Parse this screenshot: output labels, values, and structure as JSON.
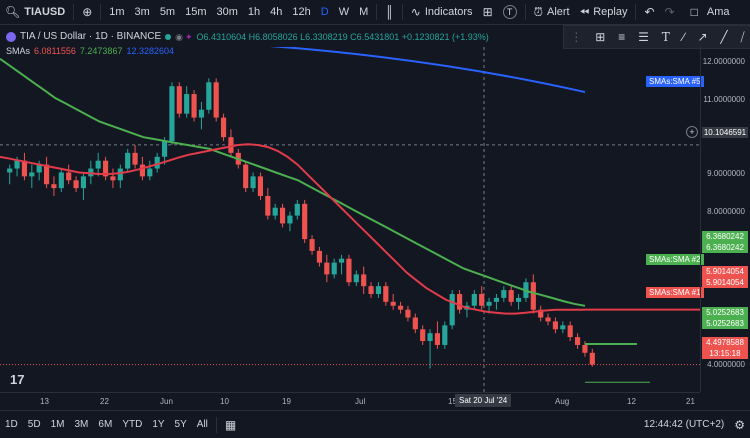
{
  "topbar": {
    "symbol": "TIAUSD",
    "intervals": [
      "1m",
      "3m",
      "5m",
      "15m",
      "30m",
      "1h",
      "4h",
      "12h",
      "D",
      "W",
      "M"
    ],
    "active_interval": "D",
    "indicators_label": "Indicators",
    "alert_label": "Alert",
    "replay_label": "Replay",
    "extra_label": "Ama"
  },
  "legend": {
    "title": "TIA / US Dollar · 1D · BINANCE",
    "ohlc": "O6.4310604 H6.8058026 L6.3308219 C6.5431801 +0.1230821 (+1.93%)",
    "sma_label": "SMAs",
    "sma1": "6.0811556",
    "sma2": "7.2473867",
    "sma3": "12.3282604"
  },
  "price_axis": {
    "labels": [
      "12.0000000",
      "11.0000000",
      "10.1046591",
      "9.0000000",
      "8.0000000",
      "6.3680242",
      "6.3680242",
      "5.9014054",
      "5.9014054",
      "5.0252683",
      "5.0252683",
      "4.4978588",
      "13:15:18",
      "4.0000000"
    ]
  },
  "sma_tags": {
    "sma5": "SMAs:SMA #5",
    "sma2": "SMAs:SMA #2",
    "sma1": "SMAs:SMA #1"
  },
  "time_axis": {
    "labels": [
      "13",
      "22",
      "Jun",
      "10",
      "19",
      "Jul",
      "15",
      "Sat 20 Jul '24",
      "Aug",
      "12",
      "21"
    ]
  },
  "bottombar": {
    "ranges": [
      "1D",
      "5D",
      "1M",
      "3M",
      "6M",
      "YTD",
      "1Y",
      "5Y",
      "All"
    ],
    "clock": "12:44:42 (UTC+2)"
  },
  "colors": {
    "up": "#26a69a",
    "down": "#ef5350",
    "sma_red": "#e23b4a",
    "sma_green": "#4caf50",
    "sma_blue": "#2962ff"
  },
  "chart_data": {
    "type": "candlestick",
    "candles": [
      [
        9.4,
        9.6,
        9.1,
        9.5
      ],
      [
        9.5,
        9.8,
        9.3,
        9.7
      ],
      [
        9.7,
        9.9,
        9.2,
        9.3
      ],
      [
        9.3,
        9.6,
        9.0,
        9.4
      ],
      [
        9.4,
        9.7,
        9.2,
        9.6
      ],
      [
        9.6,
        9.8,
        9.0,
        9.1
      ],
      [
        9.1,
        9.3,
        8.8,
        9.0
      ],
      [
        9.0,
        9.5,
        8.9,
        9.4
      ],
      [
        9.4,
        9.6,
        9.1,
        9.2
      ],
      [
        9.2,
        9.3,
        8.9,
        9.0
      ],
      [
        9.0,
        9.4,
        8.7,
        9.3
      ],
      [
        9.3,
        9.7,
        9.1,
        9.5
      ],
      [
        9.5,
        9.9,
        9.3,
        9.7
      ],
      [
        9.7,
        9.8,
        9.2,
        9.3
      ],
      [
        9.3,
        9.5,
        9.0,
        9.2
      ],
      [
        9.2,
        9.6,
        9.0,
        9.5
      ],
      [
        9.5,
        10.0,
        9.4,
        9.9
      ],
      [
        9.9,
        10.1,
        9.5,
        9.6
      ],
      [
        9.6,
        9.8,
        9.2,
        9.3
      ],
      [
        9.3,
        9.7,
        9.2,
        9.5
      ],
      [
        9.5,
        9.9,
        9.4,
        9.8
      ],
      [
        9.8,
        10.3,
        9.6,
        10.2
      ],
      [
        10.2,
        11.7,
        10.1,
        11.6
      ],
      [
        11.6,
        11.7,
        10.8,
        10.9
      ],
      [
        10.9,
        11.6,
        10.8,
        11.4
      ],
      [
        11.4,
        11.5,
        10.7,
        10.8
      ],
      [
        10.8,
        11.2,
        10.5,
        11.0
      ],
      [
        11.0,
        11.8,
        10.9,
        11.7
      ],
      [
        11.7,
        11.8,
        10.7,
        10.8
      ],
      [
        10.8,
        10.9,
        10.2,
        10.3
      ],
      [
        10.3,
        10.5,
        9.8,
        9.9
      ],
      [
        9.9,
        10.0,
        9.5,
        9.6
      ],
      [
        9.6,
        9.7,
        8.9,
        9.0
      ],
      [
        9.0,
        9.4,
        8.9,
        9.3
      ],
      [
        9.3,
        9.4,
        8.7,
        8.8
      ],
      [
        8.8,
        9.0,
        8.2,
        8.3
      ],
      [
        8.3,
        8.6,
        8.2,
        8.5
      ],
      [
        8.5,
        8.6,
        8.0,
        8.1
      ],
      [
        8.1,
        8.4,
        7.9,
        8.3
      ],
      [
        8.3,
        8.7,
        8.2,
        8.6
      ],
      [
        8.6,
        8.7,
        7.6,
        7.7
      ],
      [
        7.7,
        7.8,
        7.3,
        7.4
      ],
      [
        7.4,
        7.5,
        7.0,
        7.1
      ],
      [
        7.1,
        7.3,
        6.6,
        6.8
      ],
      [
        6.8,
        7.2,
        6.7,
        7.1
      ],
      [
        7.1,
        7.3,
        6.8,
        7.2
      ],
      [
        7.2,
        7.3,
        6.5,
        6.6
      ],
      [
        6.6,
        6.9,
        6.5,
        6.8
      ],
      [
        6.8,
        7.0,
        6.3,
        6.5
      ],
      [
        6.5,
        6.6,
        6.2,
        6.3
      ],
      [
        6.3,
        6.6,
        6.2,
        6.5
      ],
      [
        6.5,
        6.6,
        6.0,
        6.1
      ],
      [
        6.1,
        6.3,
        5.9,
        6.0
      ],
      [
        6.0,
        6.1,
        5.8,
        5.9
      ],
      [
        5.9,
        6.0,
        5.6,
        5.7
      ],
      [
        5.7,
        5.8,
        5.3,
        5.4
      ],
      [
        5.4,
        5.5,
        5.0,
        5.1
      ],
      [
        5.1,
        5.4,
        4.4,
        5.3
      ],
      [
        5.3,
        5.6,
        4.9,
        5.0
      ],
      [
        5.0,
        5.6,
        4.9,
        5.5
      ],
      [
        5.5,
        6.4,
        5.4,
        6.3
      ],
      [
        6.3,
        6.4,
        5.8,
        5.9
      ],
      [
        5.9,
        6.1,
        5.7,
        6.0
      ],
      [
        6.0,
        6.4,
        5.9,
        6.3
      ],
      [
        6.3,
        6.5,
        5.9,
        6.0
      ],
      [
        6.0,
        6.2,
        5.8,
        6.1
      ],
      [
        6.1,
        6.3,
        5.9,
        6.2
      ],
      [
        6.2,
        6.5,
        6.1,
        6.4
      ],
      [
        6.4,
        6.5,
        6.0,
        6.1
      ],
      [
        6.1,
        6.3,
        5.9,
        6.2
      ],
      [
        6.2,
        6.7,
        6.1,
        6.6
      ],
      [
        6.6,
        6.8,
        5.8,
        5.9
      ],
      [
        5.9,
        6.0,
        5.6,
        5.7
      ],
      [
        5.7,
        5.8,
        5.5,
        5.6
      ],
      [
        5.6,
        5.7,
        5.3,
        5.4
      ],
      [
        5.4,
        5.6,
        5.3,
        5.5
      ],
      [
        5.5,
        5.6,
        5.1,
        5.2
      ],
      [
        5.2,
        5.3,
        4.9,
        5.0
      ],
      [
        5.0,
        5.1,
        4.7,
        4.8
      ],
      [
        4.8,
        4.9,
        4.45,
        4.5
      ]
    ],
    "ylim": [
      3.8,
      12.6
    ],
    "sma_red": [
      9.8,
      9.75,
      9.7,
      9.65,
      9.6,
      9.55,
      9.5,
      9.45,
      9.4,
      9.38,
      9.36,
      9.36,
      9.38,
      9.42,
      9.48,
      9.55,
      9.62,
      9.7,
      9.78,
      9.85,
      9.9,
      9.95,
      10.0,
      10.05,
      10.1,
      10.12,
      10.1,
      10.05,
      9.95,
      9.8,
      9.6,
      9.35,
      9.1,
      8.85,
      8.6,
      8.35,
      8.1,
      7.85,
      7.6,
      7.35,
      7.1,
      6.85,
      6.65,
      6.45,
      6.3,
      6.15,
      6.05,
      5.95,
      5.9,
      5.85,
      5.82,
      5.8,
      5.8,
      5.82,
      5.85,
      5.88,
      5.9,
      5.9,
      5.9,
      5.9
    ],
    "sma_green": [
      12.3,
      12.1,
      11.9,
      11.7,
      11.5,
      11.3,
      11.15,
      11.0,
      10.85,
      10.7,
      10.6,
      10.5,
      10.4,
      10.3,
      10.25,
      10.2,
      10.15,
      10.1,
      10.05,
      10.0,
      9.9,
      9.8,
      9.7,
      9.6,
      9.5,
      9.4,
      9.3,
      9.2,
      9.05,
      8.9,
      8.75,
      8.6,
      8.45,
      8.3,
      8.15,
      8.0,
      7.85,
      7.7,
      7.55,
      7.4,
      7.25,
      7.1,
      6.95,
      6.85,
      6.75,
      6.65,
      6.55,
      6.45,
      6.35,
      6.28,
      6.2,
      6.12,
      6.05,
      6.0
    ]
  }
}
